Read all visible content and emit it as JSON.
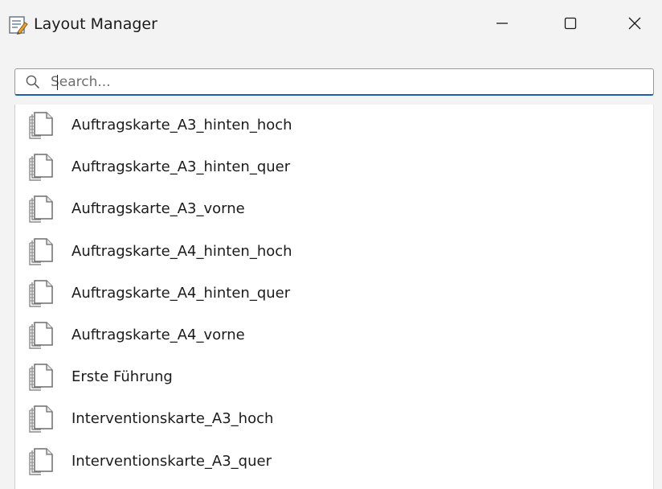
{
  "window": {
    "title": "Layout Manager",
    "app_icon": "layout-manager-icon",
    "controls": {
      "minimize_icon": "minimize-icon",
      "maximize_icon": "maximize-icon",
      "close_icon": "close-icon"
    }
  },
  "search": {
    "placeholder": "Search...",
    "value": "",
    "icon": "search-icon"
  },
  "layouts": {
    "item_icon": "layout-page-icon",
    "items": [
      {
        "label": "Auftragskarte_A3_hinten_hoch"
      },
      {
        "label": "Auftragskarte_A3_hinten_quer"
      },
      {
        "label": "Auftragskarte_A3_vorne"
      },
      {
        "label": "Auftragskarte_A4_hinten_hoch"
      },
      {
        "label": "Auftragskarte_A4_hinten_quer"
      },
      {
        "label": "Auftragskarte_A4_vorne"
      },
      {
        "label": "Erste Führung"
      },
      {
        "label": "Interventionskarte_A3_hoch"
      },
      {
        "label": "Interventionskarte_A3_quer"
      }
    ]
  },
  "colors": {
    "accent": "#1a5fb4",
    "window_bg": "#f3f3f3",
    "list_bg": "#ffffff"
  }
}
